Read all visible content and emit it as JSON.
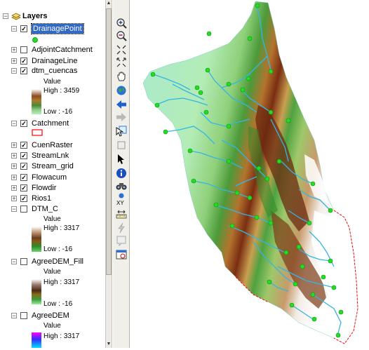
{
  "toc": {
    "root_label": "Layers",
    "layers": [
      {
        "name": "DrainagePoint",
        "checked": true,
        "expanded": true,
        "selected": true
      },
      {
        "name": "AdjointCatchment",
        "checked": false,
        "expanded": false
      },
      {
        "name": "DrainageLine",
        "checked": true,
        "expanded": false
      },
      {
        "name": "dtm_cuencas",
        "checked": true,
        "expanded": true
      },
      {
        "name": "Catchment",
        "checked": true,
        "expanded": true
      },
      {
        "name": "CuenRaster",
        "checked": true,
        "expanded": false
      },
      {
        "name": "StreamLnk",
        "checked": true,
        "expanded": false
      },
      {
        "name": "Stream_grid",
        "checked": true,
        "expanded": false
      },
      {
        "name": "Flowacum",
        "checked": true,
        "expanded": false
      },
      {
        "name": "Flowdir",
        "checked": true,
        "expanded": false
      },
      {
        "name": "Rios1",
        "checked": true,
        "expanded": false
      },
      {
        "name": "DTM_C",
        "checked": false,
        "expanded": true
      },
      {
        "name": "AgreeDEM_Fill",
        "checked": false,
        "expanded": true
      },
      {
        "name": "AgreeDEM",
        "checked": false,
        "expanded": true
      }
    ],
    "dtm_cuencas_legend": {
      "title": "Value",
      "high": "High : 3459",
      "low": "Low : -16"
    },
    "dtm_c_legend": {
      "title": "Value",
      "high": "High : 3317",
      "low": "Low : -16"
    },
    "agreedem_fill_legend": {
      "title": "Value",
      "high": "High : 3317",
      "low": "Low : -16"
    },
    "agreedem_legend": {
      "title": "Value",
      "high": "High : 3317"
    }
  },
  "toolbar": {
    "tools": [
      "zoom-in-icon",
      "zoom-out-icon",
      "fixed-zoom-in-icon",
      "fixed-zoom-out-icon",
      "pan-icon",
      "full-extent-icon",
      "back-icon",
      "forward-icon",
      "select-features-icon",
      "clear-selection-icon",
      "select-elements-icon",
      "identify-icon",
      "find-icon",
      "go-to-xy-icon",
      "measure-icon",
      "hyperlink-icon",
      "html-popup-icon",
      "time-slider-icon"
    ]
  },
  "colors": {
    "drainage_point": "#22dd22",
    "stream": "#33b5e5",
    "selection": "#3169c6",
    "catchment_outline": "#ff0000"
  }
}
